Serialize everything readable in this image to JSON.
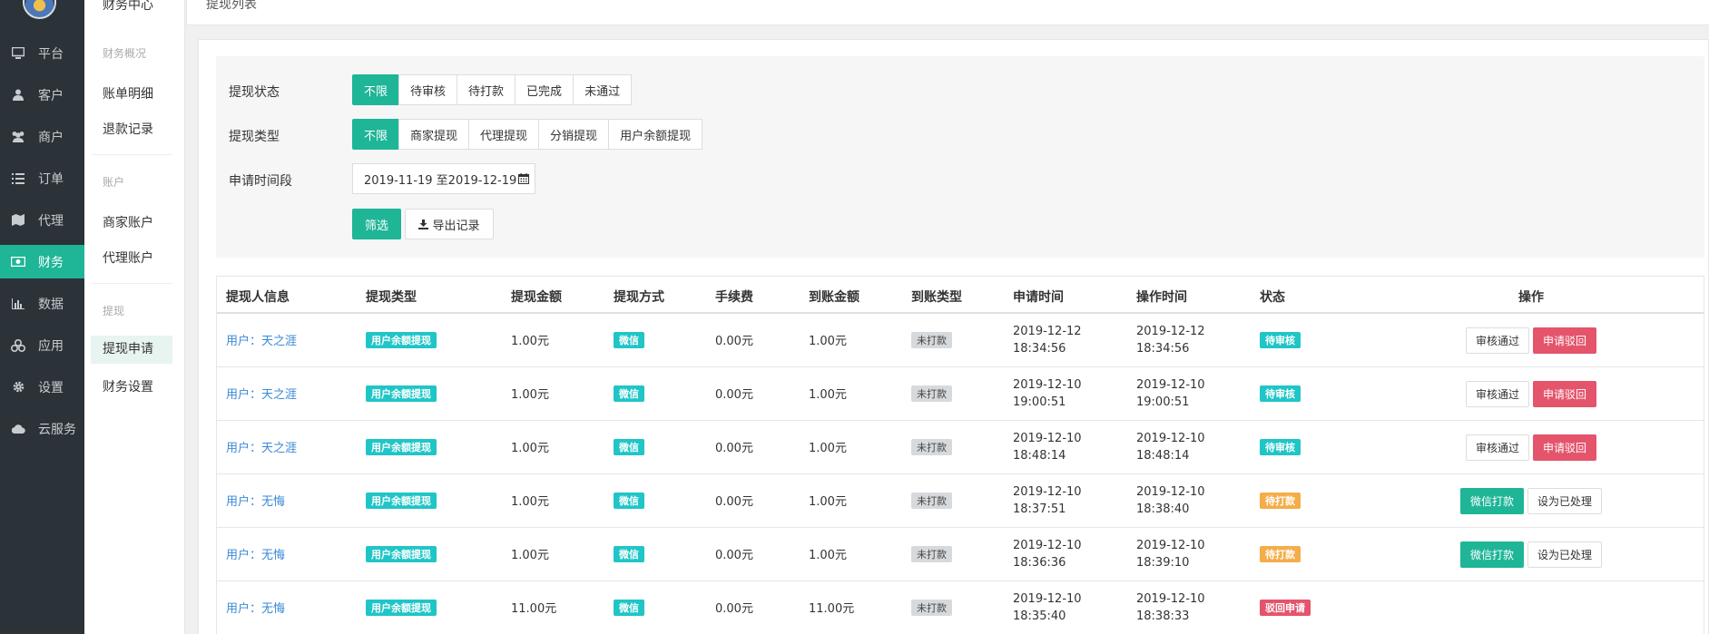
{
  "nav": {
    "items": [
      {
        "label": "平台",
        "icon": "monitor-icon"
      },
      {
        "label": "客户",
        "icon": "user-icon"
      },
      {
        "label": "商户",
        "icon": "users-icon"
      },
      {
        "label": "订单",
        "icon": "list-icon"
      },
      {
        "label": "代理",
        "icon": "map-icon"
      },
      {
        "label": "财务",
        "icon": "money-icon"
      },
      {
        "label": "数据",
        "icon": "bar-chart-icon"
      },
      {
        "label": "应用",
        "icon": "cubes-icon"
      },
      {
        "label": "设置",
        "icon": "gear-icon"
      },
      {
        "label": "云服务",
        "icon": "cloud-icon"
      }
    ],
    "active_index": 5
  },
  "submenu": {
    "header": "财务中心",
    "section1_title": "财务概况",
    "item_bills": "账单明细",
    "item_refunds": "退款记录",
    "section2_title": "账户",
    "item_merchant_account": "商家账户",
    "item_agent_account": "代理账户",
    "section3_title": "提现",
    "item_withdraw_apply": "提现申请",
    "item_finance_settings": "财务设置"
  },
  "topbar": {
    "breadcrumb": "提现列表"
  },
  "filter": {
    "status_label": "提现状态",
    "status_options": [
      "不限",
      "待审核",
      "待打款",
      "已完成",
      "未通过"
    ],
    "type_label": "提现类型",
    "type_options": [
      "不限",
      "商家提现",
      "代理提现",
      "分销提现",
      "用户余额提现"
    ],
    "period_label": "申请时间段",
    "date_range": "2019-11-19 至2019-12-19",
    "filter_button": "筛选",
    "export_button": "导出记录"
  },
  "table": {
    "headers": [
      "提现人信息",
      "提现类型",
      "提现金额",
      "提现方式",
      "手续费",
      "到账金额",
      "到账类型",
      "申请时间",
      "操作时间",
      "状态",
      "操作"
    ],
    "rows": [
      {
        "user": "用户：天之涯",
        "type": "用户余额提现",
        "amount": "1.00元",
        "method": "微信",
        "fee": "0.00元",
        "received": "1.00元",
        "receive_type": "未打款",
        "apply_date": "2019-12-12",
        "apply_time": "18:34:56",
        "op_date": "2019-12-12",
        "op_time": "18:34:56",
        "status": "待审核",
        "status_color": "teal",
        "actions": [
          "审核通过",
          "申请驳回"
        ]
      },
      {
        "user": "用户：天之涯",
        "type": "用户余额提现",
        "amount": "1.00元",
        "method": "微信",
        "fee": "0.00元",
        "received": "1.00元",
        "receive_type": "未打款",
        "apply_date": "2019-12-10",
        "apply_time": "19:00:51",
        "op_date": "2019-12-10",
        "op_time": "19:00:51",
        "status": "待审核",
        "status_color": "teal",
        "actions": [
          "审核通过",
          "申请驳回"
        ]
      },
      {
        "user": "用户：天之涯",
        "type": "用户余额提现",
        "amount": "1.00元",
        "method": "微信",
        "fee": "0.00元",
        "received": "1.00元",
        "receive_type": "未打款",
        "apply_date": "2019-12-10",
        "apply_time": "18:48:14",
        "op_date": "2019-12-10",
        "op_time": "18:48:14",
        "status": "待审核",
        "status_color": "teal",
        "actions": [
          "审核通过",
          "申请驳回"
        ]
      },
      {
        "user": "用户：无悔",
        "type": "用户余额提现",
        "amount": "1.00元",
        "method": "微信",
        "fee": "0.00元",
        "received": "1.00元",
        "receive_type": "未打款",
        "apply_date": "2019-12-10",
        "apply_time": "18:37:51",
        "op_date": "2019-12-10",
        "op_time": "18:38:40",
        "status": "待打款",
        "status_color": "orange",
        "actions": [
          "微信打款",
          "设为已处理"
        ]
      },
      {
        "user": "用户：无悔",
        "type": "用户余额提现",
        "amount": "1.00元",
        "method": "微信",
        "fee": "0.00元",
        "received": "1.00元",
        "receive_type": "未打款",
        "apply_date": "2019-12-10",
        "apply_time": "18:36:36",
        "op_date": "2019-12-10",
        "op_time": "18:39:10",
        "status": "待打款",
        "status_color": "orange",
        "actions": [
          "微信打款",
          "设为已处理"
        ]
      },
      {
        "user": "用户：无悔",
        "type": "用户余额提现",
        "amount": "11.00元",
        "method": "微信",
        "fee": "0.00元",
        "received": "11.00元",
        "receive_type": "未打款",
        "apply_date": "2019-12-10",
        "apply_time": "18:35:40",
        "op_date": "2019-12-10",
        "op_time": "18:38:33",
        "status": "驳回申请",
        "status_color": "red",
        "actions": []
      }
    ]
  }
}
